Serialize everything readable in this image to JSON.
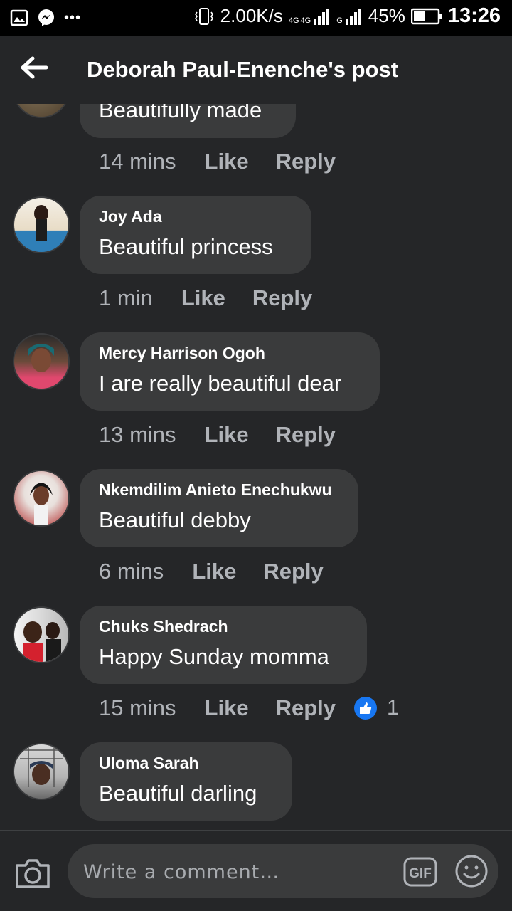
{
  "status_bar": {
    "speed": "2.00K/s",
    "net1": "4G",
    "net2": "4G",
    "net3": "G",
    "battery": "45%",
    "time": "13:26"
  },
  "header": {
    "title": "Deborah Paul-Enenche's post"
  },
  "comments": [
    {
      "name": "",
      "text": "Beautifully made",
      "time": "14 mins",
      "like": "Like",
      "reply": "Reply"
    },
    {
      "name": "Joy Ada",
      "text": "Beautiful princess",
      "time": "1 min",
      "like": "Like",
      "reply": "Reply"
    },
    {
      "name": "Mercy Harrison Ogoh",
      "text": "I are really beautiful dear",
      "time": "13 mins",
      "like": "Like",
      "reply": "Reply"
    },
    {
      "name": "Nkemdilim Anieto Enechukwu",
      "text": "Beautiful debby",
      "time": "6 mins",
      "like": "Like",
      "reply": "Reply"
    },
    {
      "name": "Chuks Shedrach",
      "text": "Happy Sunday momma",
      "time": "15 mins",
      "like": "Like",
      "reply": "Reply",
      "reactions": "1"
    },
    {
      "name": "Uloma Sarah",
      "text": "Beautiful darling"
    }
  ],
  "composer": {
    "placeholder": "Write a comment…",
    "gif": "GIF"
  },
  "colors": {
    "background": "#252628",
    "bubble": "#3a3b3c",
    "like_blue": "#1877f2"
  }
}
